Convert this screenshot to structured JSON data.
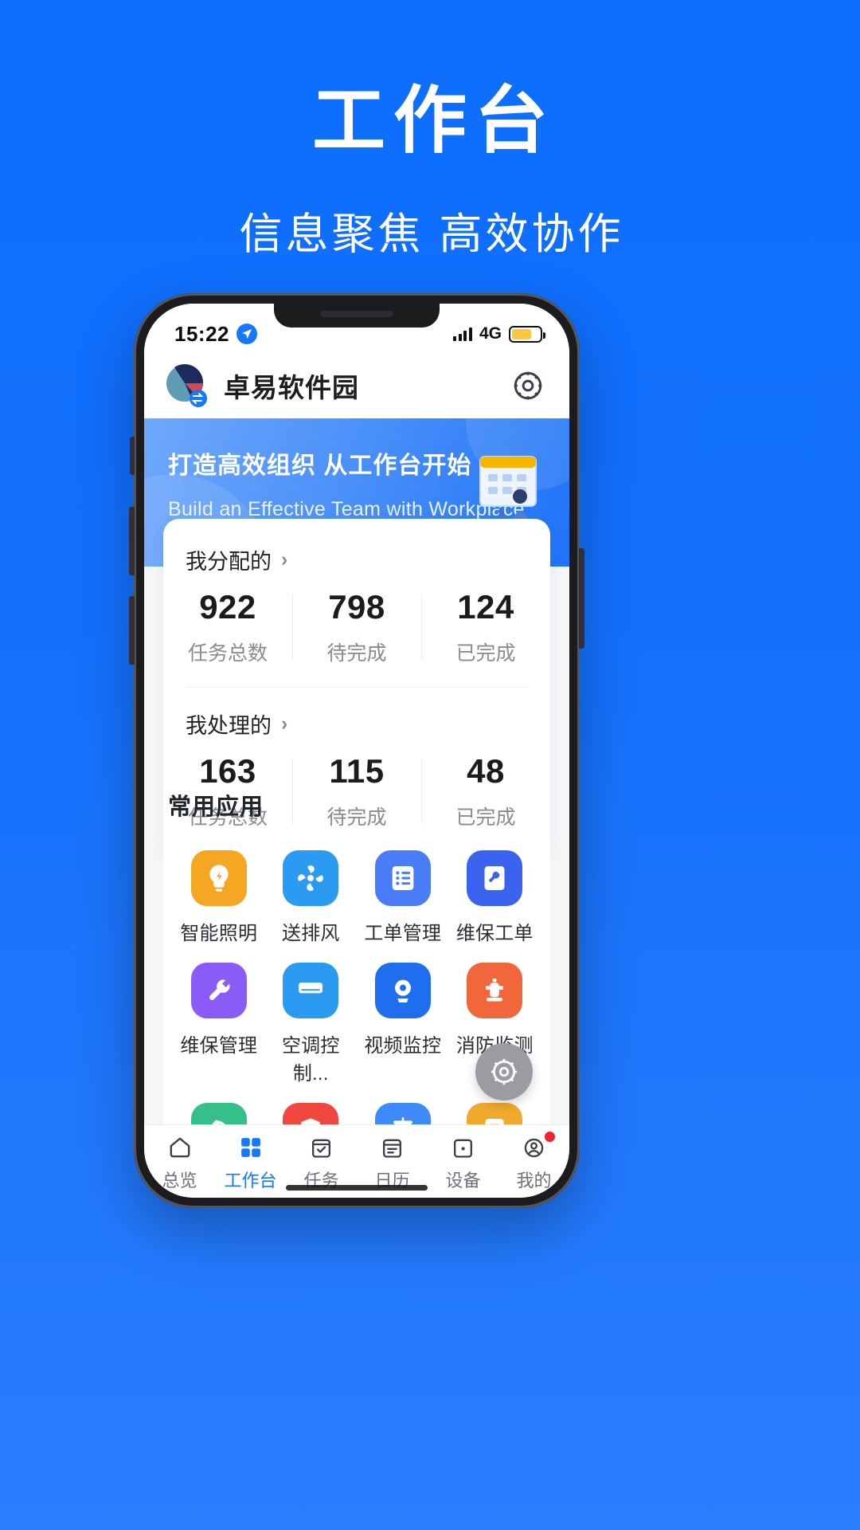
{
  "promo": {
    "title": "工作台",
    "subtitle": "信息聚焦  高效协作"
  },
  "colors": {
    "page_bg": "#1370fc",
    "accent": "#1677ff",
    "banner_from": "#6ea8fb",
    "banner_to": "#1e73f7"
  },
  "statusbar": {
    "time": "15:22",
    "location_icon": "location-arrow-icon",
    "network": "4G",
    "signal_icon": "signal-bars-icon",
    "battery_icon": "battery-icon"
  },
  "appbar": {
    "brand": "卓易软件园",
    "logo_icon": "company-logo-icon",
    "settings_icon": "gear-icon"
  },
  "banner": {
    "title": "打造高效组织 从工作台开始",
    "subtitle": "Build an Effective Team with Workplace",
    "art_icon": "calendar-person-illustration"
  },
  "stats": [
    {
      "label": "我分配的",
      "chevron": "›",
      "cells": [
        {
          "value": "922",
          "label": "任务总数"
        },
        {
          "value": "798",
          "label": "待完成"
        },
        {
          "value": "124",
          "label": "已完成"
        }
      ]
    },
    {
      "label": "我处理的",
      "chevron": "›",
      "cells": [
        {
          "value": "163",
          "label": "任务总数"
        },
        {
          "value": "115",
          "label": "待完成"
        },
        {
          "value": "48",
          "label": "已完成"
        }
      ]
    }
  ],
  "apps_section": {
    "title": "常用应用",
    "items": [
      {
        "label": "智能照明",
        "icon": "lightbulb-icon",
        "color": "#f5a623"
      },
      {
        "label": "送排风",
        "icon": "fan-icon",
        "color": "#2a9bf0"
      },
      {
        "label": "工单管理",
        "icon": "list-document-icon",
        "color": "#4a7cf7"
      },
      {
        "label": "维保工单",
        "icon": "wrench-document-icon",
        "color": "#3a63f0"
      },
      {
        "label": "维保管理",
        "icon": "wrench-icon",
        "color": "#8a5cf6"
      },
      {
        "label": "空调控制...",
        "icon": "air-conditioner-icon",
        "color": "#2a9bf0"
      },
      {
        "label": "视频监控",
        "icon": "cctv-camera-icon",
        "color": "#1f6ef0"
      },
      {
        "label": "消防监测",
        "icon": "fire-hydrant-icon",
        "color": "#f2663c"
      },
      {
        "label": "",
        "icon": "recycle-icon",
        "color": "#35c08a"
      },
      {
        "label": "",
        "icon": "shield-bolt-icon",
        "color": "#f0483e"
      },
      {
        "label": "",
        "icon": "trash-bin-icon",
        "color": "#3d8bf8"
      },
      {
        "label": "",
        "icon": "energy-report-icon",
        "color": "#f0a92c"
      }
    ],
    "fab_icon": "settings-gear-fab-icon"
  },
  "tabbar": {
    "items": [
      {
        "label": "总览",
        "icon": "home-icon",
        "active": false,
        "badge": false
      },
      {
        "label": "工作台",
        "icon": "grid-icon",
        "active": true,
        "badge": false
      },
      {
        "label": "任务",
        "icon": "task-check-icon",
        "active": false,
        "badge": false
      },
      {
        "label": "日历",
        "icon": "calendar-icon",
        "active": false,
        "badge": false
      },
      {
        "label": "设备",
        "icon": "device-icon",
        "active": false,
        "badge": false
      },
      {
        "label": "我的",
        "icon": "person-icon",
        "active": false,
        "badge": true
      }
    ]
  }
}
